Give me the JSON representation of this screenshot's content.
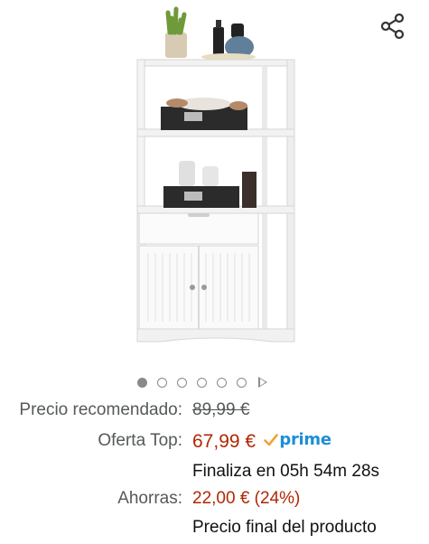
{
  "product": {
    "image_alt": "Mueble de baño blanco con estantes, cajón y dos puertas"
  },
  "carousel": {
    "count": 6,
    "active_index": 0
  },
  "icons": {
    "share": "share-icon",
    "play": "play-icon",
    "prime_check": "check-icon"
  },
  "pricing": {
    "list_label": "Precio recomendado:",
    "list_price": "89,99 €",
    "deal_label": "Oferta Top:",
    "deal_price": "67,99 €",
    "prime_label": "prime",
    "deal_ends": "Finaliza en 05h 54m 28s",
    "savings_label": "Ahorras:",
    "savings_value": "22,00 € (24%)",
    "final_note": "Precio final del producto"
  },
  "colors": {
    "price": "#b12704",
    "prime": "#1d8ed8",
    "muted": "#565959"
  }
}
